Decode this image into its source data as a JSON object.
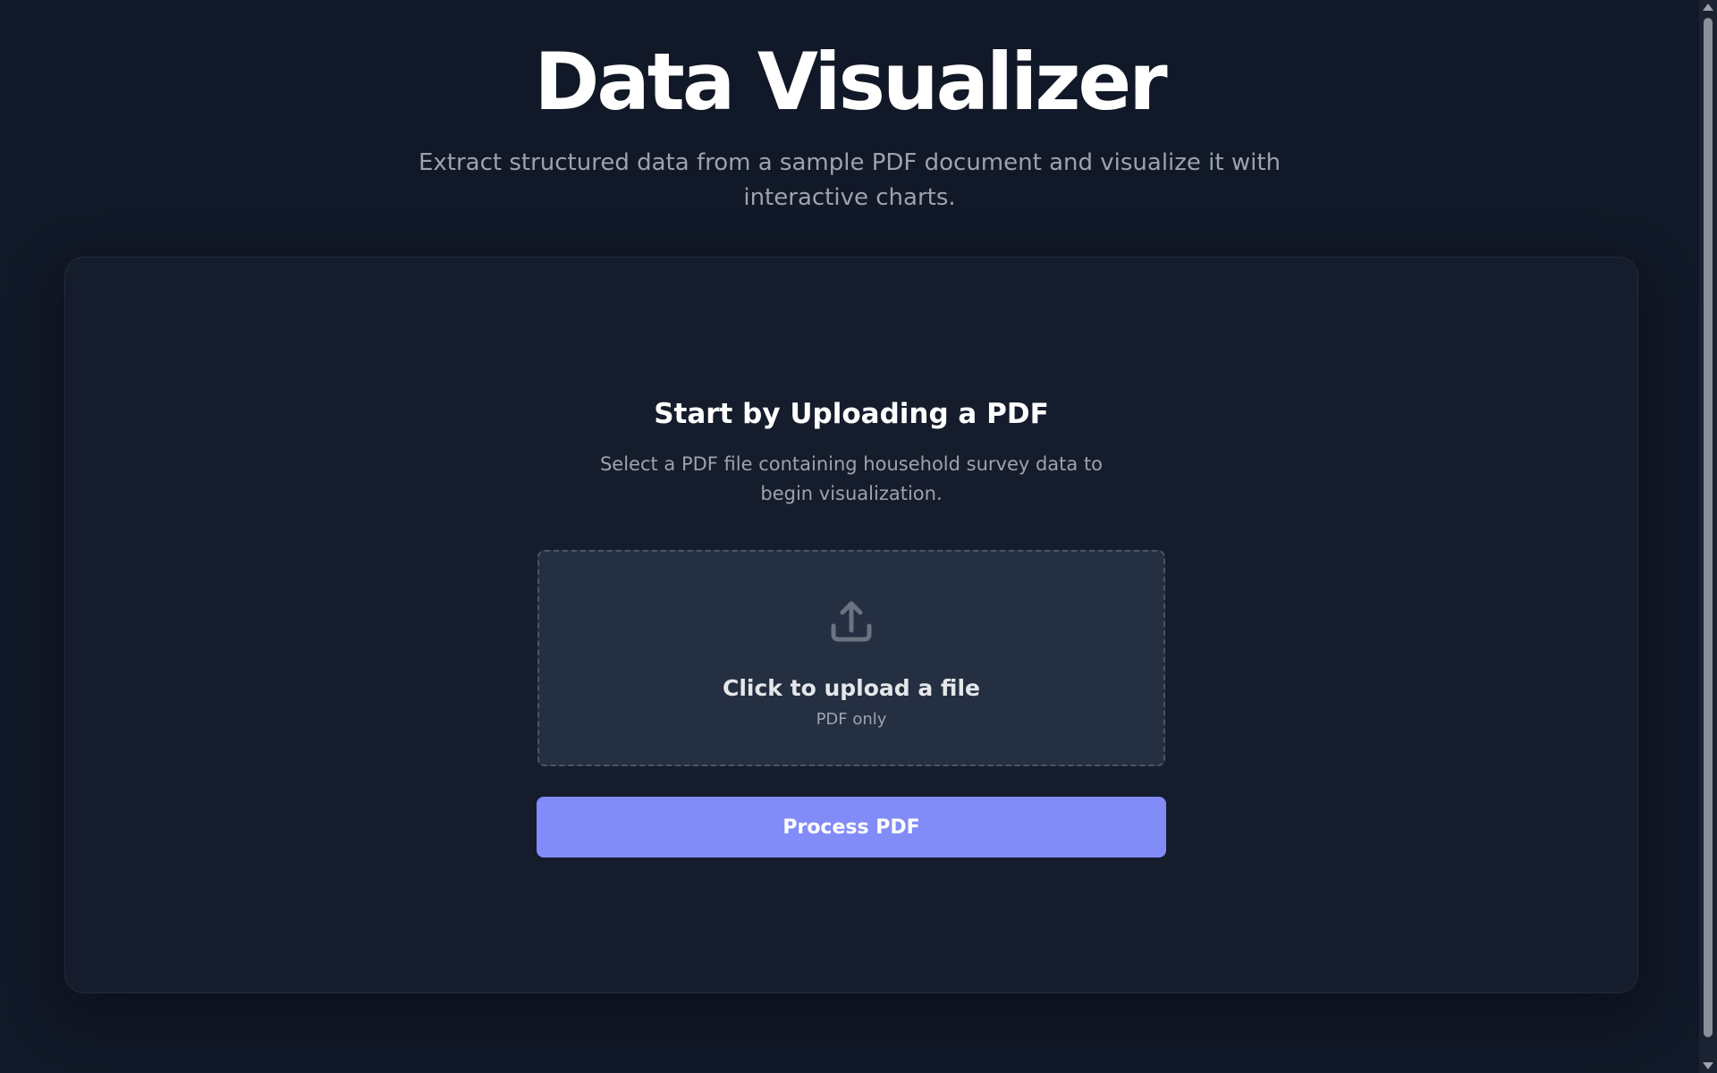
{
  "header": {
    "title": "Data Visualizer",
    "subtitle": "Extract structured data from a sample PDF document and visualize it with interactive charts."
  },
  "upload_card": {
    "title": "Start by Uploading a PDF",
    "description": "Select a PDF file containing household survey data to begin visualization.",
    "dropzone": {
      "label": "Click to upload a file",
      "hint": "PDF only",
      "icon": "upload-icon"
    },
    "process_button_label": "Process PDF"
  },
  "colors": {
    "background": "#111827",
    "card": "#151c2c",
    "dropzone": "#252f42",
    "accent": "#818cf8",
    "muted_text": "#9ca3af"
  }
}
